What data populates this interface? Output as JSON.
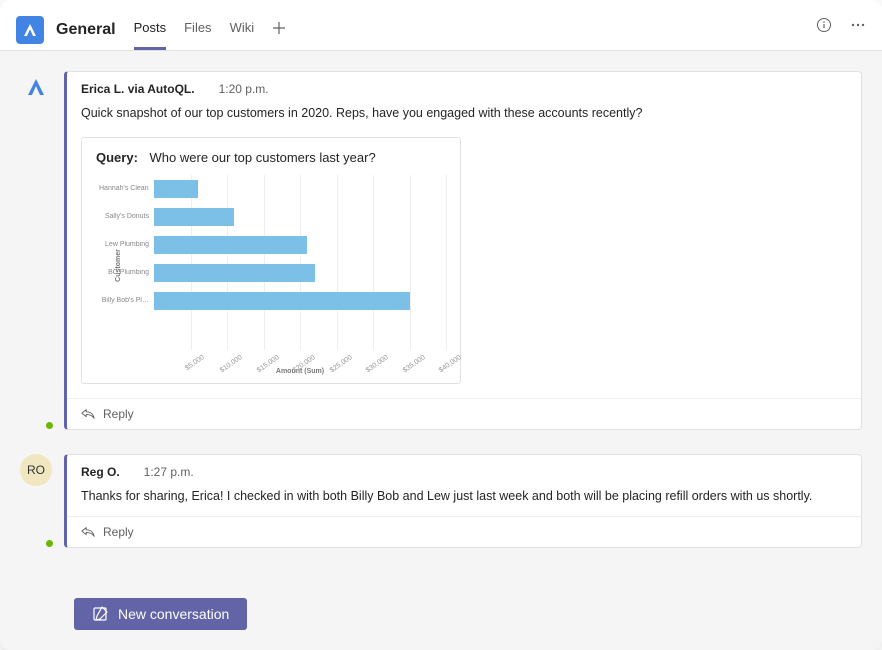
{
  "header": {
    "channel_name": "General",
    "tabs": [
      {
        "label": "Posts",
        "active": true
      },
      {
        "label": "Files",
        "active": false
      },
      {
        "label": "Wiki",
        "active": false
      }
    ],
    "icons": {
      "info": "info-icon",
      "more": "more-icon",
      "add_tab": "plus-icon"
    }
  },
  "posts": [
    {
      "id": "p1",
      "avatar_type": "app",
      "avatar_initials": "",
      "author": "Erica L. via AutoQL.",
      "time": "1:20 p.m.",
      "text": "Quick snapshot of our top customers in 2020. Reps, have you engaged with these accounts recently?",
      "has_chart": true,
      "reply_label": "Reply"
    },
    {
      "id": "p2",
      "avatar_type": "user",
      "avatar_initials": "RO",
      "author": "Reg O.",
      "time": "1:27 p.m.",
      "text": "Thanks for sharing, Erica! I checked in with both Billy Bob and Lew just last week and both will be placing refill orders with us shortly.",
      "has_chart": false,
      "reply_label": "Reply"
    }
  ],
  "compose": {
    "new_conversation_label": "New conversation"
  },
  "chart_data": {
    "type": "bar",
    "orientation": "horizontal",
    "query_label": "Query:",
    "query_text": "Who were our top customers last year?",
    "xlabel": "Amount (Sum)",
    "ylabel": "Customer",
    "xlim": [
      0,
      40000
    ],
    "ticks": [
      5000,
      10000,
      15000,
      20000,
      25000,
      30000,
      35000,
      40000
    ],
    "tick_labels": [
      "$5,000",
      "$10,000",
      "$15,000",
      "$20,000",
      "$25,000",
      "$30,000",
      "$35,000",
      "$40,000"
    ],
    "series": [
      {
        "name": "Hannah's Cleaners",
        "value": 6000
      },
      {
        "name": "Sally's Donuts",
        "value": 11000
      },
      {
        "name": "Lew Plumbing",
        "value": 21000
      },
      {
        "name": "BC Plumbing",
        "value": 22000
      },
      {
        "name": "Billy Bob's Pl…",
        "value": 35000
      }
    ]
  }
}
